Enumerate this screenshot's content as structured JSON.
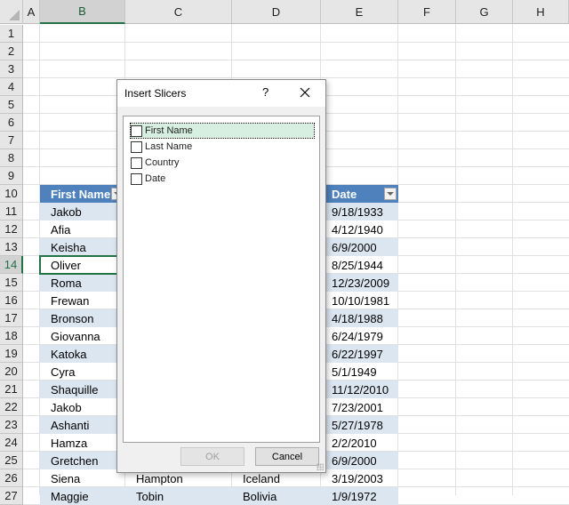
{
  "columns": [
    "A",
    "B",
    "C",
    "D",
    "E",
    "F",
    "G",
    "H"
  ],
  "selected_column": "B",
  "rows": [
    "1",
    "2",
    "3",
    "4",
    "5",
    "6",
    "7",
    "8",
    "9",
    "10",
    "11",
    "12",
    "13",
    "14",
    "15",
    "16",
    "17",
    "18",
    "19",
    "20",
    "21",
    "22",
    "23",
    "24",
    "25",
    "26",
    "27"
  ],
  "selected_row": "14",
  "table": {
    "headers": {
      "first_name": "First Name",
      "date": "Date"
    },
    "first_names": [
      "Jakob",
      "Afia",
      "Keisha",
      "Oliver",
      "Roma",
      "Frewan",
      "Bronson",
      "Giovanna",
      "Katoka",
      "Cyra",
      "Shaquille",
      "Jakob",
      "Ashanti",
      "Hamza",
      "Gretchen",
      "Siena",
      "Maggie"
    ],
    "last_names_visible": {
      "row26": "Hampton",
      "row27": "Tobin"
    },
    "countries_visible": {
      "row26": "Iceland",
      "row27": "Bolivia"
    },
    "dates": [
      "9/18/1933",
      "4/12/1940",
      "6/9/2000",
      "8/25/1944",
      "12/23/2009",
      "10/10/1981",
      "4/18/1988",
      "6/24/1979",
      "6/22/1997",
      "5/1/1949",
      "11/12/2010",
      "7/23/2001",
      "5/27/1978",
      "2/2/2010",
      "6/9/2000",
      "3/19/2003",
      "1/9/1972"
    ]
  },
  "dialog": {
    "title": "Insert Slicers",
    "help_label": "?",
    "close_icon": "close-icon",
    "fields": [
      {
        "label": "First Name",
        "checked": false,
        "focused": true
      },
      {
        "label": "Last Name",
        "checked": false,
        "focused": false
      },
      {
        "label": "Country",
        "checked": false,
        "focused": false
      },
      {
        "label": "Date",
        "checked": false,
        "focused": false
      }
    ],
    "ok_label": "OK",
    "ok_enabled": false,
    "cancel_label": "Cancel"
  },
  "colors": {
    "table_header": "#4f81bd",
    "band": "#dce6f1",
    "selection_green": "#217346",
    "focus_item": "#d6efe0"
  }
}
